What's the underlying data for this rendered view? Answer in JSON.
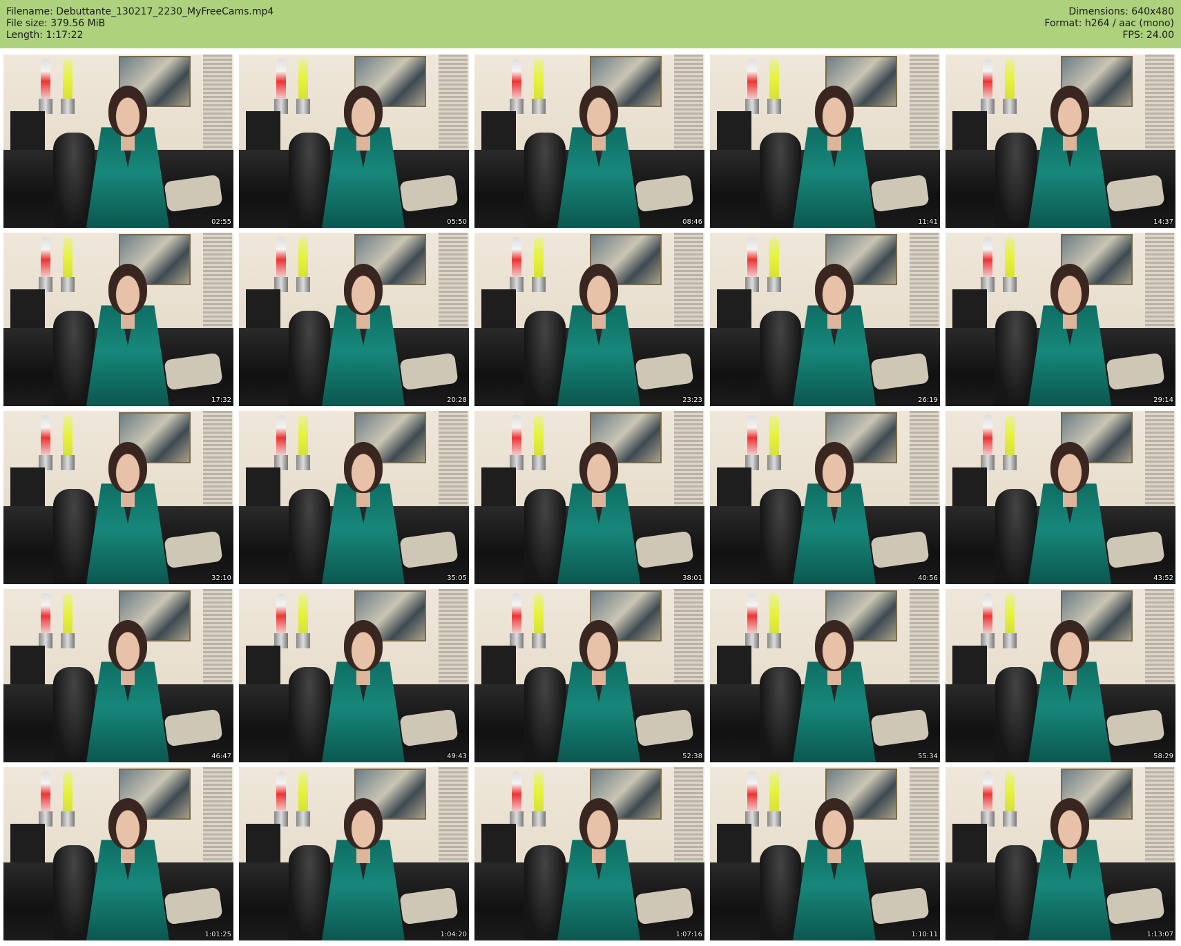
{
  "header": {
    "filename_label": "Filename: Debuttante_130217_2230_MyFreeCams.mp4",
    "filesize_label": "File size: 379.56 MiB",
    "length_label": "Length: 1:17:22",
    "dimensions_label": "Dimensions: 640x480",
    "format_label": "Format: h264 / aac (mono)",
    "fps_label": "FPS: 24.00",
    "background_color": "#add17c"
  },
  "thumbnails": [
    {
      "time": "02:55"
    },
    {
      "time": "05:50"
    },
    {
      "time": "08:46"
    },
    {
      "time": "11:41"
    },
    {
      "time": "14:37"
    },
    {
      "time": "17:32"
    },
    {
      "time": "20:28"
    },
    {
      "time": "23:23"
    },
    {
      "time": "26:19"
    },
    {
      "time": "29:14"
    },
    {
      "time": "32:10"
    },
    {
      "time": "35:05"
    },
    {
      "time": "38:01"
    },
    {
      "time": "40:56"
    },
    {
      "time": "43:52"
    },
    {
      "time": "46:47"
    },
    {
      "time": "49:43"
    },
    {
      "time": "52:38"
    },
    {
      "time": "55:34"
    },
    {
      "time": "58:29"
    },
    {
      "time": "1:01:25"
    },
    {
      "time": "1:04:20"
    },
    {
      "time": "1:07:16"
    },
    {
      "time": "1:10:11"
    },
    {
      "time": "1:13:07"
    }
  ]
}
